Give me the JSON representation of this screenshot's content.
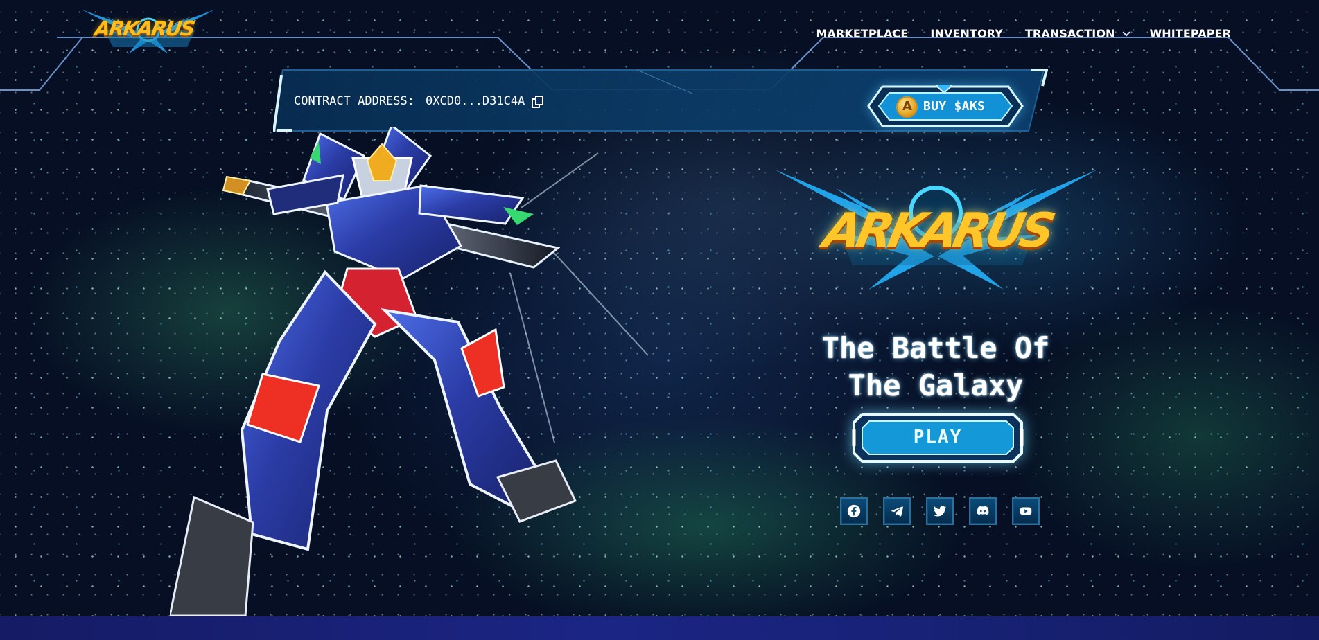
{
  "brand": {
    "small_logo_text": "ARKARUS",
    "main_logo_text": "ARKARUS"
  },
  "nav": {
    "items": [
      {
        "label": "MARKETPLACE"
      },
      {
        "label": "INVENTORY"
      },
      {
        "label": "TRANSACTION",
        "has_dropdown": true
      },
      {
        "label": "WHITEPAPER"
      }
    ]
  },
  "contract": {
    "label": "CONTRACT ADDRESS:",
    "address": "0XCD0...D31C4A",
    "copy_icon": "copy-icon"
  },
  "buy": {
    "label": "BUY $AKS",
    "icon": "token-icon"
  },
  "hero": {
    "title": "The Battle Of\nThe Galaxy",
    "play_label": "PLAY"
  },
  "social": [
    {
      "icon": "facebook-icon"
    },
    {
      "icon": "telegram-icon"
    },
    {
      "icon": "twitter-icon"
    },
    {
      "icon": "discord-icon"
    },
    {
      "icon": "youtube-icon"
    }
  ],
  "colors": {
    "background": "#071226",
    "accent_blue": "#159bd8",
    "logo_gold": "#ffc629",
    "nav_text": "#ffffff"
  }
}
